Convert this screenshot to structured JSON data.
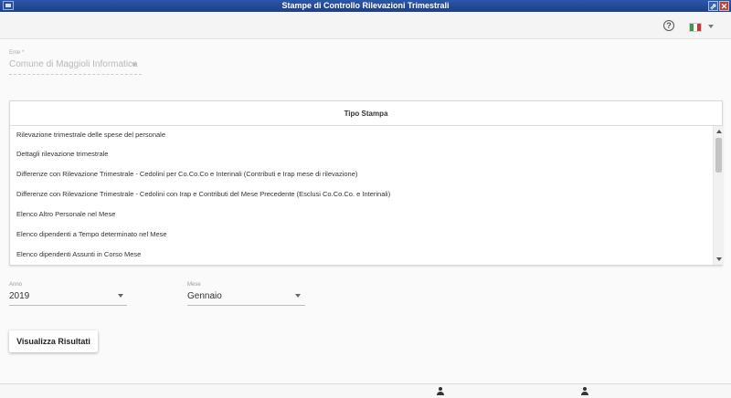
{
  "window": {
    "title": "Stampe di Controllo Rilevazioni Trimestrali",
    "restore_glyph": "⇗",
    "close_glyph": "✕"
  },
  "toolbar": {
    "help_glyph": "?",
    "language": "it"
  },
  "ente": {
    "label": "Ente *",
    "value": "Comune di Maggioli Informatica"
  },
  "table": {
    "header": "Tipo Stampa",
    "rows": [
      "Rilevazione trimestrale delle spese del personale",
      "Dettagli rilevazione trimestrale",
      "Differenze con Rilevazione Trimestrale - Cedolini per Co.Co.Co e Interinali (Contributi e Irap mese di rilevazione)",
      "Differenze con Rilevazione Trimestrale - Cedolini con Irap e Contributi del Mese Precedente (Esclusi Co.Co.Co. e Interinali)",
      "Elenco Altro Personale nel Mese",
      "Elenco dipendenti a Tempo determinato nel Mese",
      "Elenco dipendenti Assunti in Corso Mese"
    ]
  },
  "anno": {
    "label": "Anno",
    "value": "2019"
  },
  "mese": {
    "label": "Mese",
    "value": "Gennaio"
  },
  "actions": {
    "submit_label": "Visualizza Risultati"
  },
  "colors": {
    "titlebar": "#1f468f",
    "background": "#fafafa",
    "flag": [
      "#3a9a48",
      "#ffffff",
      "#d2342c"
    ]
  }
}
